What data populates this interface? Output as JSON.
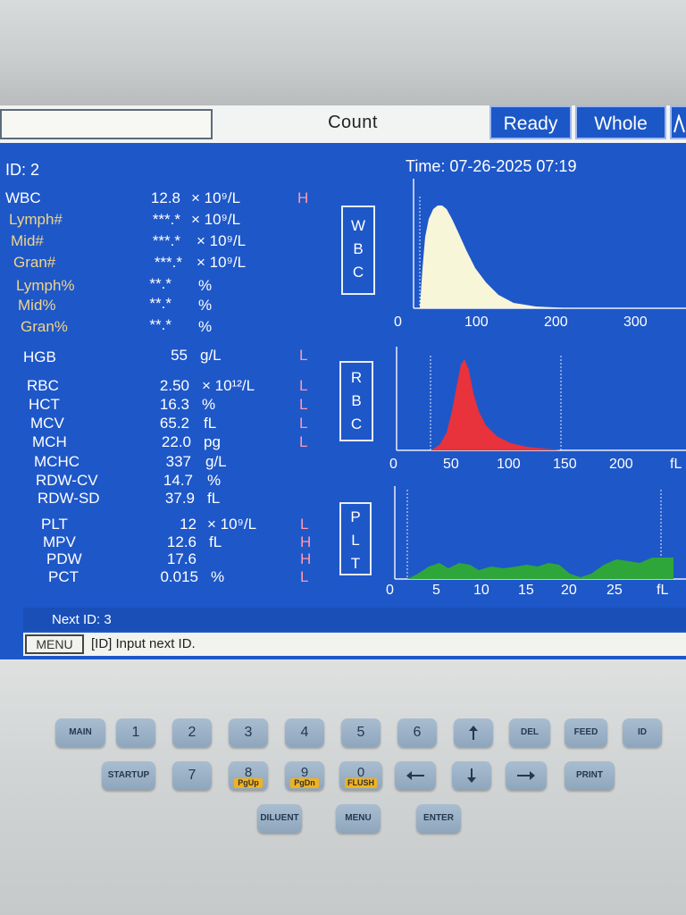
{
  "topbar": {
    "title": "Count",
    "mode_ready": "Ready",
    "mode_whole": "Whole"
  },
  "header": {
    "id": "ID: 2",
    "time": "Time: 07-26-2025 07:19"
  },
  "wbc_params": [
    {
      "name": "WBC",
      "value": "12.8",
      "unit": "× 10⁹/L",
      "flag": "H"
    },
    {
      "name": "Lymph#",
      "value": "***.*",
      "unit": "× 10⁹/L",
      "flag": ""
    },
    {
      "name": "Mid#",
      "value": "***.*",
      "unit": "× 10⁹/L",
      "flag": ""
    },
    {
      "name": "Gran#",
      "value": "***.*",
      "unit": "× 10⁹/L",
      "flag": ""
    },
    {
      "name": "Lymph%",
      "value": "**.*",
      "unit": "%",
      "flag": ""
    },
    {
      "name": "Mid%",
      "value": "**.*",
      "unit": "%",
      "flag": ""
    },
    {
      "name": "Gran%",
      "value": "**.*",
      "unit": "%",
      "flag": ""
    }
  ],
  "hgb_param": {
    "name": "HGB",
    "value": "55",
    "unit": "g/L",
    "flag": "L"
  },
  "rbc_params": [
    {
      "name": "RBC",
      "value": "2.50",
      "unit": "× 10¹²/L",
      "flag": "L"
    },
    {
      "name": "HCT",
      "value": "16.3",
      "unit": "%",
      "flag": "L"
    },
    {
      "name": "MCV",
      "value": "65.2",
      "unit": "fL",
      "flag": "L"
    },
    {
      "name": "MCH",
      "value": "22.0",
      "unit": "pg",
      "flag": "L"
    },
    {
      "name": "MCHC",
      "value": "337",
      "unit": "g/L",
      "flag": ""
    },
    {
      "name": "RDW-CV",
      "value": "14.7",
      "unit": "%",
      "flag": ""
    },
    {
      "name": "RDW-SD",
      "value": "37.9",
      "unit": "fL",
      "flag": ""
    }
  ],
  "plt_params": [
    {
      "name": "PLT",
      "value": "12",
      "unit": "× 10⁹/L",
      "flag": "L"
    },
    {
      "name": "MPV",
      "value": "12.6",
      "unit": "fL",
      "flag": "H"
    },
    {
      "name": "PDW",
      "value": "17.6",
      "unit": "",
      "flag": "H"
    },
    {
      "name": "PCT",
      "value": "0.015",
      "unit": "%",
      "flag": "L"
    }
  ],
  "side_labels": {
    "wbc": [
      "W",
      "B",
      "C"
    ],
    "rbc": [
      "R",
      "B",
      "C"
    ],
    "plt": [
      "P",
      "L",
      "T"
    ]
  },
  "histograms": {
    "wbc": {
      "ticks": [
        "0",
        "100",
        "200",
        "300"
      ],
      "color": "#f8f6d8"
    },
    "rbc": {
      "ticks": [
        "0",
        "50",
        "100",
        "150",
        "200",
        "fL"
      ],
      "color": "#e8323c"
    },
    "plt": {
      "ticks": [
        "0",
        "5",
        "10",
        "15",
        "20",
        "25",
        "fL"
      ],
      "color": "#2fa63a"
    }
  },
  "footer": {
    "next_id": "Next ID: 3",
    "menu_label": "MENU",
    "status": "[ID] Input next ID."
  },
  "keypad": {
    "main": "MAIN",
    "k1": "1",
    "k2": "2",
    "k3": "3",
    "k4": "4",
    "k5": "5",
    "k6": "6",
    "del": "DEL",
    "feed": "FEED",
    "id": "ID",
    "startup": "STARTUP",
    "k7": "7",
    "k8": "8",
    "pgup": "PgUp",
    "k9": "9",
    "pgdn": "PgDn",
    "k0": "0",
    "flush": "FLUSH",
    "print": "PRINT",
    "diluent": "DILUENT",
    "menu": "MENU",
    "enter": "ENTER"
  }
}
